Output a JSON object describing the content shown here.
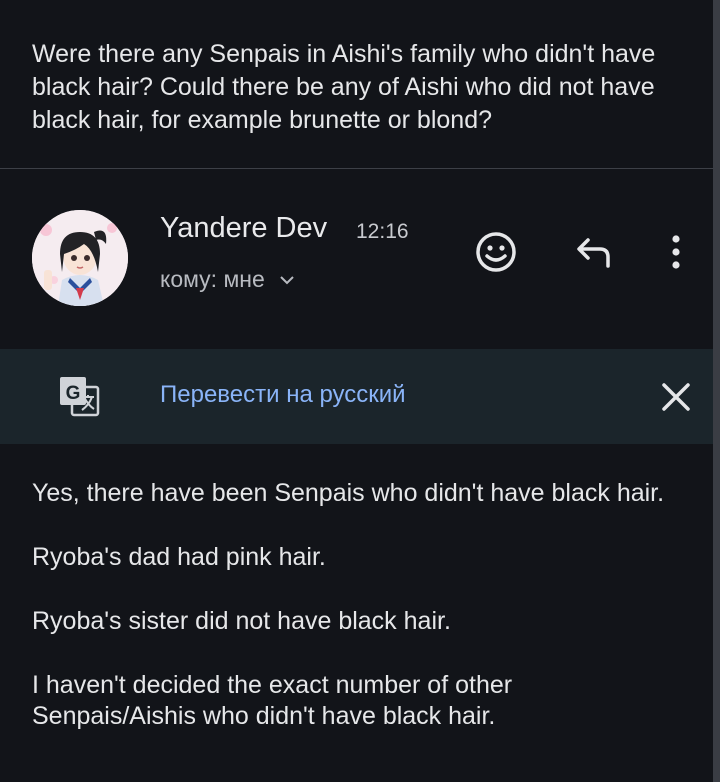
{
  "question": "Were there any Senpais in Aishi's family who didn't have black hair? Could there be any of Aishi who did not have black hair, for example brunette or blond?",
  "message": {
    "sender": "Yandere Dev",
    "time": "12:16",
    "recipient": "кому: мне",
    "paragraphs": [
      "Yes, there have been Senpais who didn't have black hair.",
      "Ryoba's dad had pink hair.",
      "Ryoba's sister did not have black hair.",
      "I haven't decided the exact number of other Senpais/Aishis who didn't have black hair."
    ]
  },
  "translate": {
    "link": "Перевести на русский",
    "icon": "google-translate-icon"
  },
  "icons": {
    "emoji": "add-reaction-icon",
    "reply": "reply-icon",
    "more": "more-vert-icon",
    "close": "close-icon",
    "recipient_toggle": "chevron-down-icon"
  },
  "colors": {
    "background": "#121419",
    "translate_bar": "#1b252b",
    "link": "#8ab4f8",
    "text": "#e6e7e9"
  }
}
